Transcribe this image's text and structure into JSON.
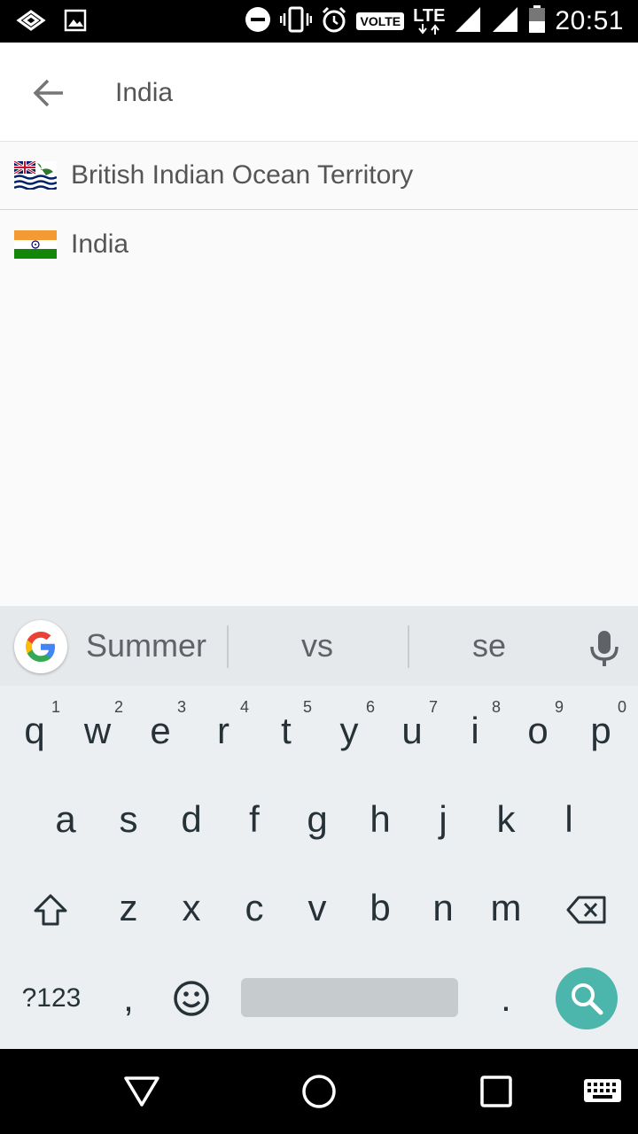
{
  "status_bar": {
    "time": "20:51",
    "network_badge": "VOLTE",
    "network_type": "LTE",
    "icons": [
      "cast-icon",
      "image-icon",
      "dnd-icon",
      "vibrate-icon",
      "alarm-icon",
      "signal-icon",
      "signal-icon",
      "battery-icon"
    ]
  },
  "search": {
    "value": "India",
    "placeholder": ""
  },
  "results": [
    {
      "label": "British Indian Ocean Territory",
      "flag": "british-indian-ocean-territory-flag"
    },
    {
      "label": "India",
      "flag": "india-flag"
    }
  ],
  "keyboard": {
    "suggestions": [
      "Summer",
      "vs",
      "se"
    ],
    "row1": [
      {
        "key": "q",
        "hint": "1"
      },
      {
        "key": "w",
        "hint": "2"
      },
      {
        "key": "e",
        "hint": "3"
      },
      {
        "key": "r",
        "hint": "4"
      },
      {
        "key": "t",
        "hint": "5"
      },
      {
        "key": "y",
        "hint": "6"
      },
      {
        "key": "u",
        "hint": "7"
      },
      {
        "key": "i",
        "hint": "8"
      },
      {
        "key": "o",
        "hint": "9"
      },
      {
        "key": "p",
        "hint": "0"
      }
    ],
    "row2": [
      "a",
      "s",
      "d",
      "f",
      "g",
      "h",
      "j",
      "k",
      "l"
    ],
    "row3": [
      "z",
      "x",
      "c",
      "v",
      "b",
      "n",
      "m"
    ],
    "symbols_label": "?123",
    "comma": ",",
    "period": "."
  },
  "colors": {
    "accent": "#4db6ac",
    "keyboard_bg": "#eceff1",
    "text_secondary": "#555555"
  }
}
